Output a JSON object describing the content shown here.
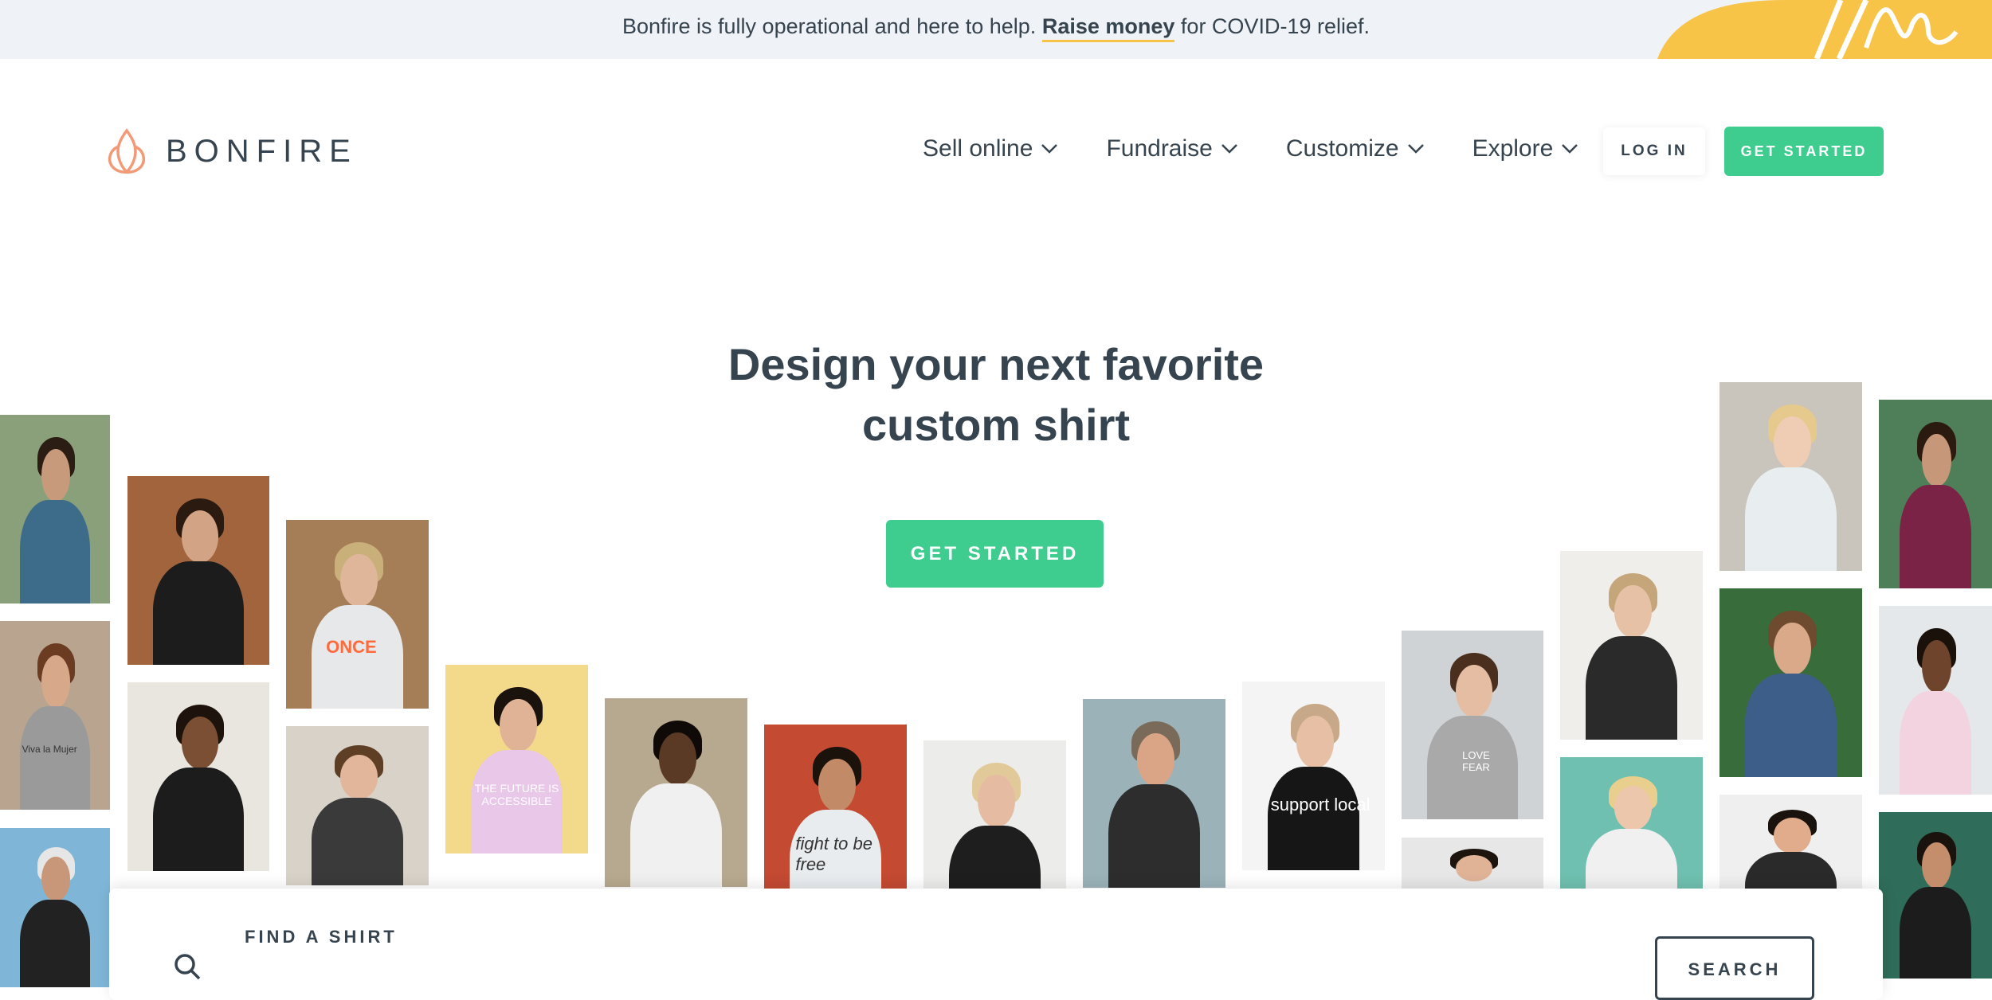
{
  "announcement": {
    "prefix": "Bonfire is fully operational and here to help.",
    "link": "Raise money",
    "suffix": "for COVID-19 relief."
  },
  "brand": {
    "name": "BONFIRE",
    "accent": "#3ecd8f",
    "logo_color": "#f29a78"
  },
  "nav": {
    "items": [
      {
        "label": "Sell online",
        "icon": "chevron-down-icon"
      },
      {
        "label": "Fundraise",
        "icon": "chevron-down-icon"
      },
      {
        "label": "Customize",
        "icon": "chevron-down-icon"
      },
      {
        "label": "Explore",
        "icon": "chevron-down-icon"
      }
    ],
    "login": "LOG IN",
    "get_started": "GET STARTED"
  },
  "hero": {
    "title_line1": "Design your next favorite",
    "title_line2": "custom shirt",
    "cta": "GET STARTED"
  },
  "photo_texts": {
    "p_once": "ONCE",
    "p_future": "THE FUTURE IS ACCESSIBLE",
    "p_fight": "fight to be free",
    "p_support": "support local",
    "p_love": "LOVE FEAR",
    "p_viva": "Viva la Mujer"
  },
  "search": {
    "label": "FIND A SHIRT",
    "button": "SEARCH"
  }
}
